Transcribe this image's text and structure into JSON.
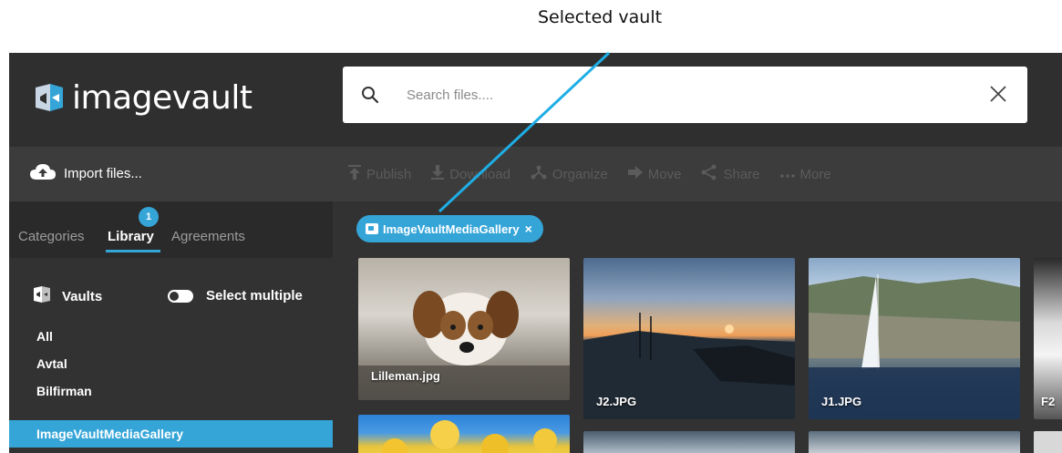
{
  "annotation": {
    "label": "Selected vault"
  },
  "header": {
    "logo_text": "imagevault",
    "search": {
      "placeholder": "Search files....",
      "value": ""
    }
  },
  "actions": {
    "import_label": "Import files...",
    "toolbar": [
      {
        "label": "Publish",
        "icon": "publish-icon"
      },
      {
        "label": "Download",
        "icon": "download-icon"
      },
      {
        "label": "Organize",
        "icon": "organize-icon"
      },
      {
        "label": "Move",
        "icon": "move-icon"
      },
      {
        "label": "Share",
        "icon": "share-icon"
      },
      {
        "label": "More",
        "icon": "more-icon"
      }
    ]
  },
  "tabs": {
    "categories": "Categories",
    "library": "Library",
    "library_badge": "1",
    "agreements": "Agreements"
  },
  "vaults": {
    "heading": "Vaults",
    "select_multiple": "Select multiple",
    "items": [
      "All",
      "Avtal",
      "Bilfirman",
      "ImageVaultMediaGallery"
    ],
    "selected_index": 3
  },
  "filter_chip": {
    "label": "ImageVaultMediaGallery",
    "close": "×"
  },
  "gallery": {
    "items": [
      {
        "caption": "Lilleman.jpg"
      },
      {
        "caption": "J2.JPG"
      },
      {
        "caption": "J1.JPG"
      },
      {
        "caption": "F2"
      }
    ]
  },
  "colors": {
    "accent": "#35a5d8",
    "background": "#323232",
    "topbar": "#2f2f30"
  }
}
